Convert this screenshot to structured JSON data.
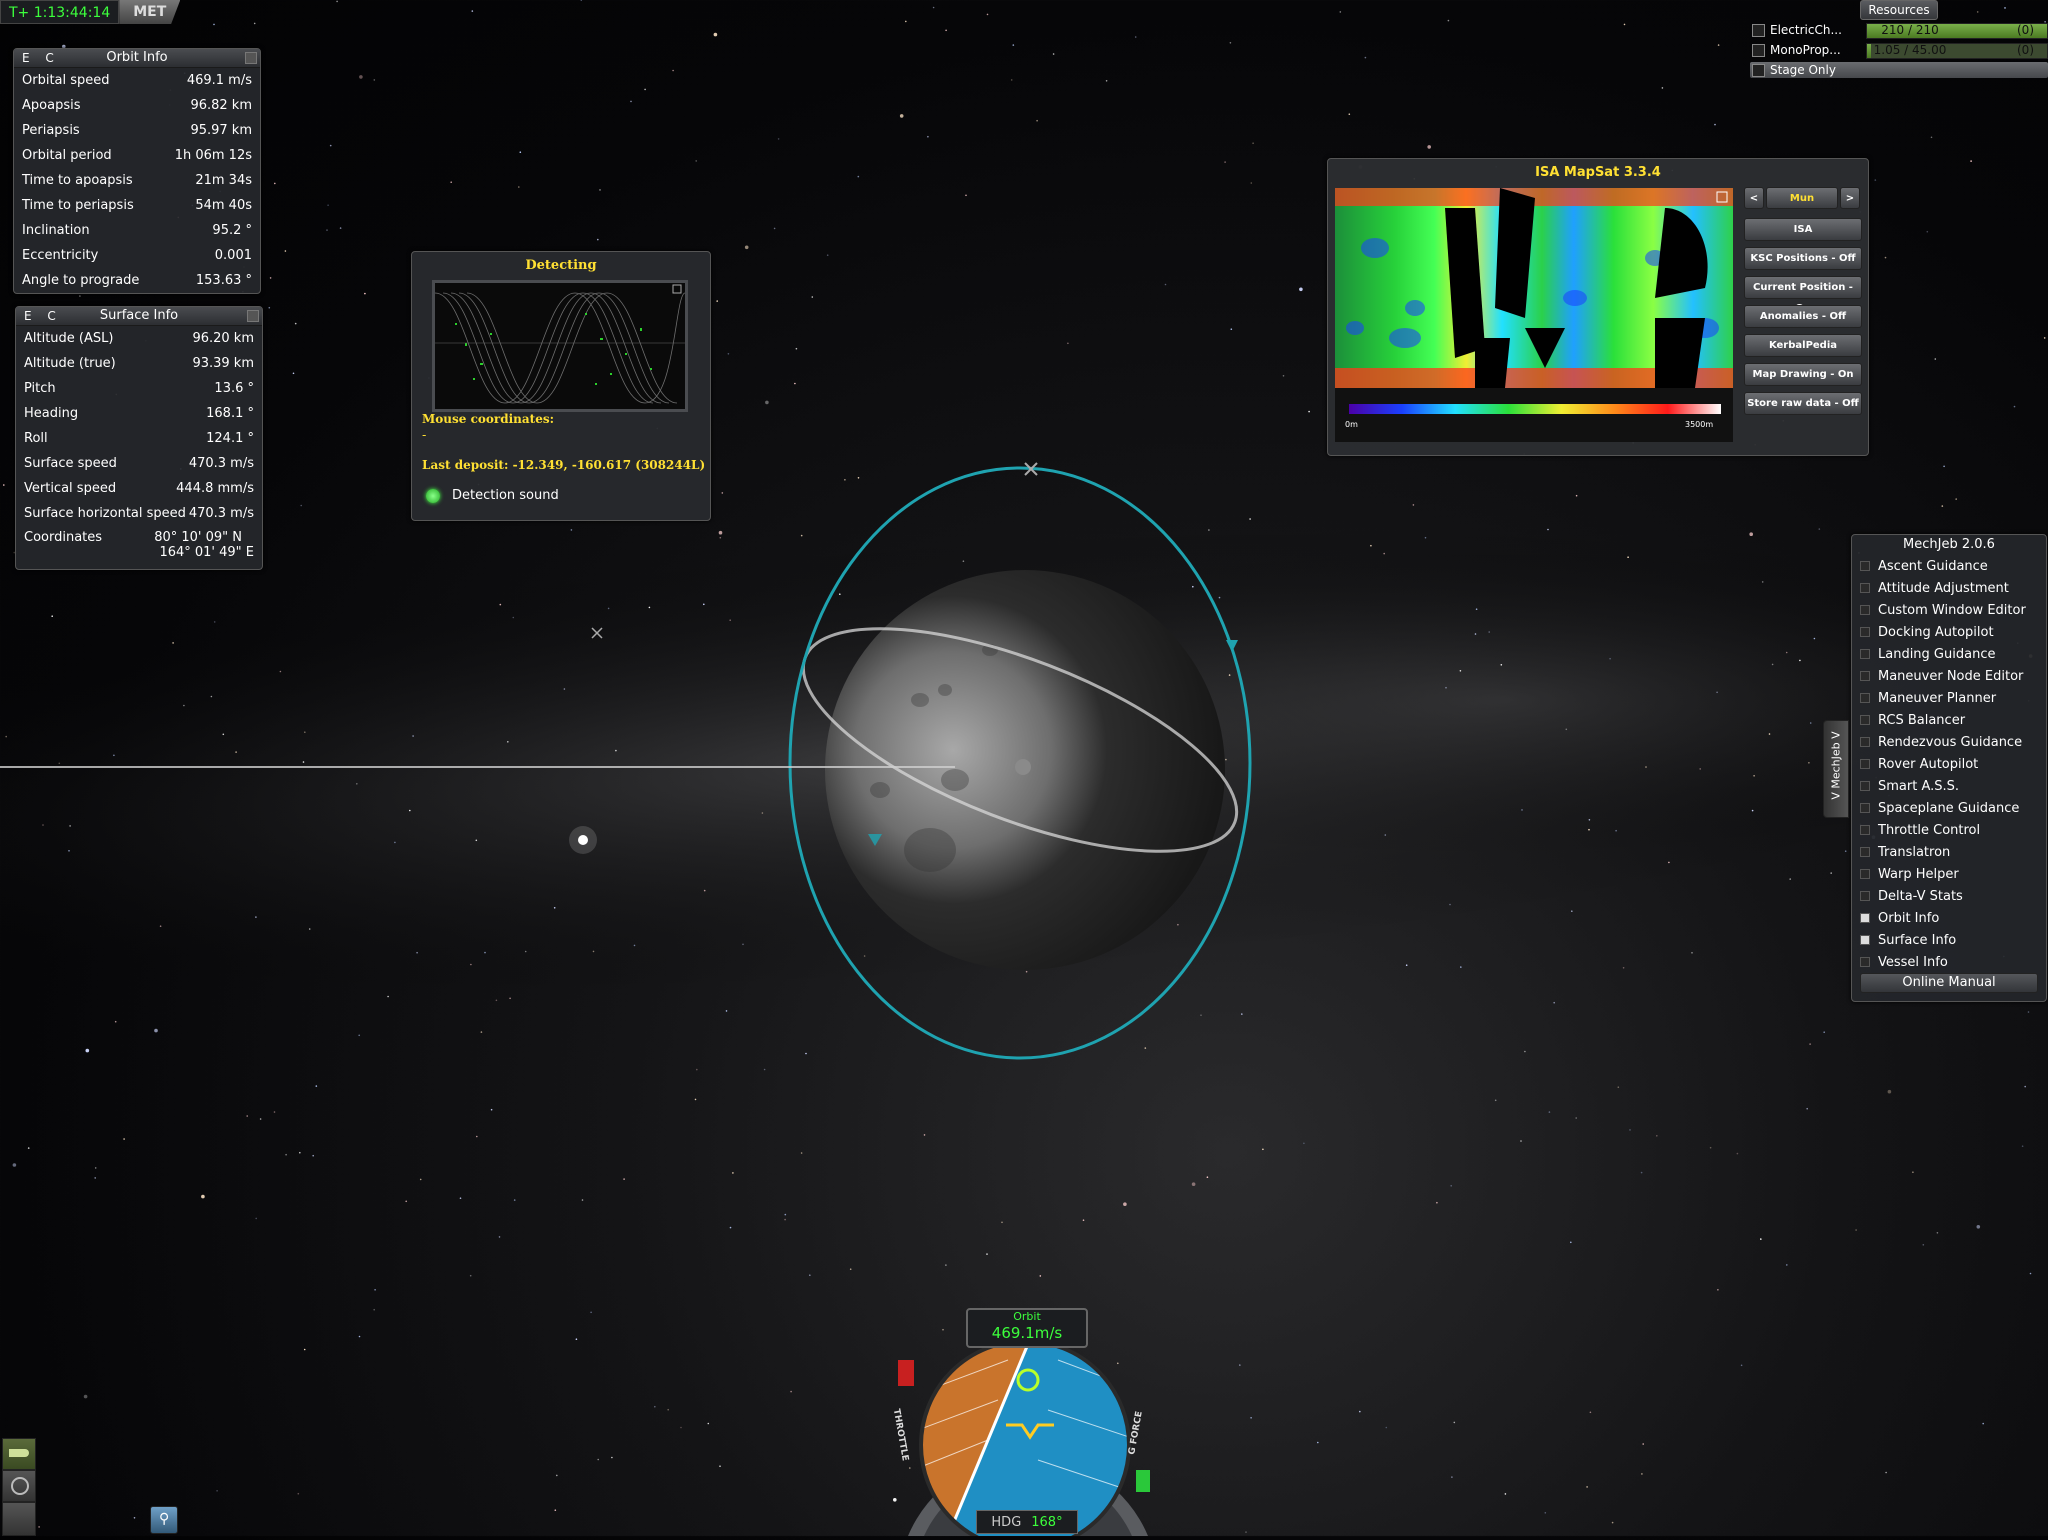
{
  "met": {
    "time": "T+ 1:13:44:14",
    "label": "MET"
  },
  "orbit_info": {
    "ec": "E C",
    "title": "Orbit Info",
    "rows": [
      {
        "label": "Orbital speed",
        "value": "469.1 m/s"
      },
      {
        "label": "Apoapsis",
        "value": "96.82 km"
      },
      {
        "label": "Periapsis",
        "value": "95.97 km"
      },
      {
        "label": "Orbital period",
        "value": "1h 06m 12s"
      },
      {
        "label": "Time to apoapsis",
        "value": "21m 34s"
      },
      {
        "label": "Time to periapsis",
        "value": "54m 40s"
      },
      {
        "label": "Inclination",
        "value": "95.2 °"
      },
      {
        "label": "Eccentricity",
        "value": "0.001"
      },
      {
        "label": "Angle to prograde",
        "value": "153.63 °"
      }
    ]
  },
  "surface_info": {
    "ec": "E C",
    "title": "Surface Info",
    "rows": [
      {
        "label": "Altitude (ASL)",
        "value": "96.20 km"
      },
      {
        "label": "Altitude (true)",
        "value": "93.39 km"
      },
      {
        "label": "Pitch",
        "value": "13.6 °"
      },
      {
        "label": "Heading",
        "value": "168.1 °"
      },
      {
        "label": "Roll",
        "value": "124.1 °"
      },
      {
        "label": "Surface speed",
        "value": "470.3 m/s"
      },
      {
        "label": "Vertical speed",
        "value": "444.8 mm/s"
      },
      {
        "label": "Surface horizontal speed",
        "value": "470.3 m/s"
      }
    ],
    "coord_label": "Coordinates",
    "coord_lat": "80° 10' 09\" N",
    "coord_lon": "164° 01' 49\" E"
  },
  "detecting": {
    "title": "Detecting",
    "mouse_label": "Mouse coordinates:",
    "mouse_value": "-",
    "last_deposit": "Last deposit: -12.349, -160.617 (308244L)",
    "sound_label": "Detection sound"
  },
  "mapsat": {
    "title": "ISA MapSat 3.3.4",
    "prev": "<",
    "next": ">",
    "body": "Mun",
    "scale_min": "0m",
    "scale_max": "3500m",
    "buttons": [
      "ISA",
      "KSC Positions - Off",
      "Current Position - On",
      "Anomalies - Off",
      "KerbalPedia",
      "Map Drawing - On",
      "Store raw data - Off"
    ]
  },
  "resources": {
    "title": "Resources",
    "rows": [
      {
        "name": "ElectricCh...",
        "amount": "210 / 210",
        "extra": "(0)",
        "fill_fraction": 1.0
      },
      {
        "name": "MonoProp...",
        "amount": "1.05 / 45.00",
        "extra": "(0)",
        "fill_fraction": 0.023
      }
    ],
    "stage_only": "Stage Only"
  },
  "mechjeb": {
    "title": "MechJeb 2.0.6",
    "tab": "V MechJeb V",
    "items": [
      {
        "label": "Ascent Guidance",
        "on": false
      },
      {
        "label": "Attitude Adjustment",
        "on": false
      },
      {
        "label": "Custom Window Editor",
        "on": false
      },
      {
        "label": "Docking Autopilot",
        "on": false
      },
      {
        "label": "Landing Guidance",
        "on": false
      },
      {
        "label": "Maneuver Node Editor",
        "on": false
      },
      {
        "label": "Maneuver Planner",
        "on": false
      },
      {
        "label": "RCS Balancer",
        "on": false
      },
      {
        "label": "Rendezvous Guidance",
        "on": false
      },
      {
        "label": "Rover Autopilot",
        "on": false
      },
      {
        "label": "Smart A.S.S.",
        "on": false
      },
      {
        "label": "Spaceplane Guidance",
        "on": false
      },
      {
        "label": "Throttle Control",
        "on": false
      },
      {
        "label": "Translatron",
        "on": false
      },
      {
        "label": "Warp Helper",
        "on": false
      },
      {
        "label": "Delta-V Stats",
        "on": false
      },
      {
        "label": "Orbit Info",
        "on": true
      },
      {
        "label": "Surface Info",
        "on": true
      },
      {
        "label": "Vessel Info",
        "on": false
      }
    ],
    "manual": "Online Manual"
  },
  "navball": {
    "mode": "Orbit",
    "speed": "469.1m/s",
    "heading_label": "HDG",
    "heading_value": "168°",
    "throttle_label": "THROTTLE",
    "gforce_label": "G FORCE"
  },
  "colors": {
    "orbit_cyan": "#1fa3b0",
    "orbit_white": "#d8d8d8",
    "accent_yellow": "#ffe033",
    "met_green": "#3cff3c"
  }
}
